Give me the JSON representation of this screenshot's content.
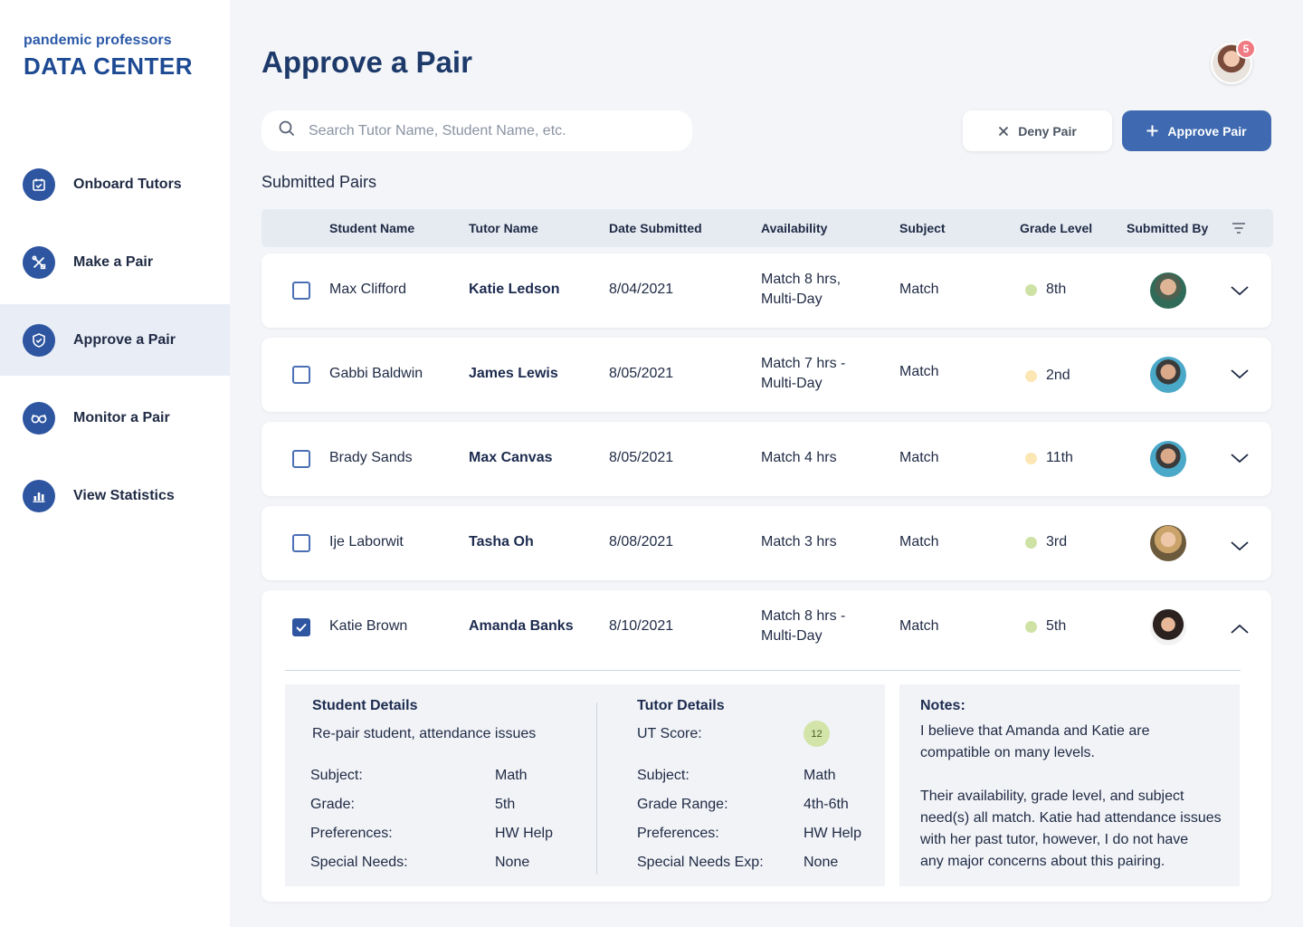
{
  "brand": {
    "small": "pandemic professors",
    "big": "DATA CENTER"
  },
  "nav": [
    {
      "label": "Onboard Tutors",
      "icon": "calendar-check-icon",
      "active": false
    },
    {
      "label": "Make a Pair",
      "icon": "tools-icon",
      "active": false
    },
    {
      "label": "Approve a Pair",
      "icon": "shield-check-icon",
      "active": true
    },
    {
      "label": "Monitor a Pair",
      "icon": "glasses-icon",
      "active": false
    },
    {
      "label": "View Statistics",
      "icon": "bar-chart-icon",
      "active": false
    }
  ],
  "header": {
    "title": "Approve a Pair",
    "notification_count": "5"
  },
  "search": {
    "placeholder": "Search Tutor Name, Student Name, etc."
  },
  "actions": {
    "deny_label": "Deny Pair",
    "approve_label": "Approve Pair"
  },
  "section_title": "Submitted Pairs",
  "columns": [
    "Student Name",
    "Tutor Name",
    "Date Submitted",
    "Availability",
    "Subject",
    "Grade Level",
    "Submitted By"
  ],
  "rows": [
    {
      "student": "Max Clifford",
      "tutor": "Katie Ledson",
      "date": "8/04/2021",
      "availability_1": "Match 8 hrs,",
      "availability_2": "Multi-Day",
      "subject": "Match",
      "grade": "8th",
      "grade_color": "#cfe2a6",
      "checked": false
    },
    {
      "student": "Gabbi Baldwin",
      "tutor": "James Lewis",
      "date": "8/05/2021",
      "availability_1": "Match 7 hrs -",
      "availability_2": "Multi-Day",
      "subject": "Match",
      "grade": "2nd",
      "grade_color": "#fbe6b4",
      "checked": false
    },
    {
      "student": "Brady Sands",
      "tutor": "Max Canvas",
      "date": "8/05/2021",
      "availability_1": "Match 4 hrs",
      "availability_2": "",
      "subject": "Match",
      "grade": "11th",
      "grade_color": "#fbe6b4",
      "checked": false
    },
    {
      "student": "Ije Laborwit",
      "tutor": "Tasha Oh",
      "date": "8/08/2021",
      "availability_1": "Match 3 hrs",
      "availability_2": "",
      "subject": "Match",
      "grade": "3rd",
      "grade_color": "#cfe2a6",
      "checked": false
    },
    {
      "student": "Katie Brown",
      "tutor": "Amanda Banks",
      "date": "8/10/2021",
      "availability_1": "Match 8 hrs -",
      "availability_2": "Multi-Day",
      "subject": "Match",
      "grade": "5th",
      "grade_color": "#cfe2a6",
      "checked": true
    }
  ],
  "details": {
    "student_head": "Student Details",
    "student_note": "Re-pair student, attendance issues",
    "student_fields": [
      {
        "label": "Subject:",
        "value": "Math"
      },
      {
        "label": "Grade:",
        "value": "5th"
      },
      {
        "label": "Preferences:",
        "value": "HW Help"
      },
      {
        "label": "Special Needs:",
        "value": "None"
      }
    ],
    "tutor_head": "Tutor Details",
    "ut_label": "UT Score:",
    "ut_score": "12",
    "tutor_fields": [
      {
        "label": "Subject:",
        "value": "Math"
      },
      {
        "label": "Grade Range:",
        "value": "4th-6th"
      },
      {
        "label": "Preferences:",
        "value": "HW Help"
      },
      {
        "label": "Special Needs Exp:",
        "value": "None"
      }
    ],
    "notes_head": "Notes:",
    "notes_lines": [
      "I believe that Amanda and Katie are",
      "compatible on many levels.",
      "",
      "Their availability, grade level, and subject",
      "need(s) all match. Katie had attendance issues",
      "with her past tutor, however, I do not have",
      "any major concerns about this pairing."
    ]
  }
}
